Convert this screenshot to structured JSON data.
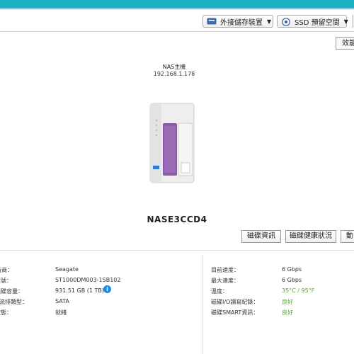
{
  "toolbar": {
    "external_storage_label": "外接儲存裝置",
    "ssd_overprovision_label": "SSD 預留空間"
  },
  "overview_button_label": "效能",
  "nas": {
    "label": "NAS主機",
    "ip": "192.168.1.178"
  },
  "disk": {
    "name": "NASE3CCD4"
  },
  "actions": {
    "disk_info": "磁碟資訊",
    "disk_health": "磁碟健康狀況",
    "third": "動"
  },
  "left_info": [
    {
      "label": "製造商：",
      "value": "Seagate"
    },
    {
      "label": "型號：",
      "value": "ST1000DM003-1SB102"
    },
    {
      "label": "磁碟容量：",
      "value": "931.51 GB (1 TB)"
    },
    {
      "label": "匯流排類型：",
      "value": "SATA"
    },
    {
      "label": "狀態：",
      "value": "就緒"
    }
  ],
  "right_info": [
    {
      "label": "目前速度：",
      "value": "6 Gbps"
    },
    {
      "label": "最大速度：",
      "value": "6 Gbps"
    },
    {
      "label": "溫度：",
      "value": "35°C / 95°F"
    },
    {
      "label": "磁碟I/O讀寫紀錄：",
      "value": "良好"
    },
    {
      "label": "磁碟SMART資訊：",
      "value": "良好"
    }
  ],
  "colors": {
    "accent": "#1bb3c4",
    "good": "#58a628",
    "drive_purple": "#8a5aa8"
  }
}
